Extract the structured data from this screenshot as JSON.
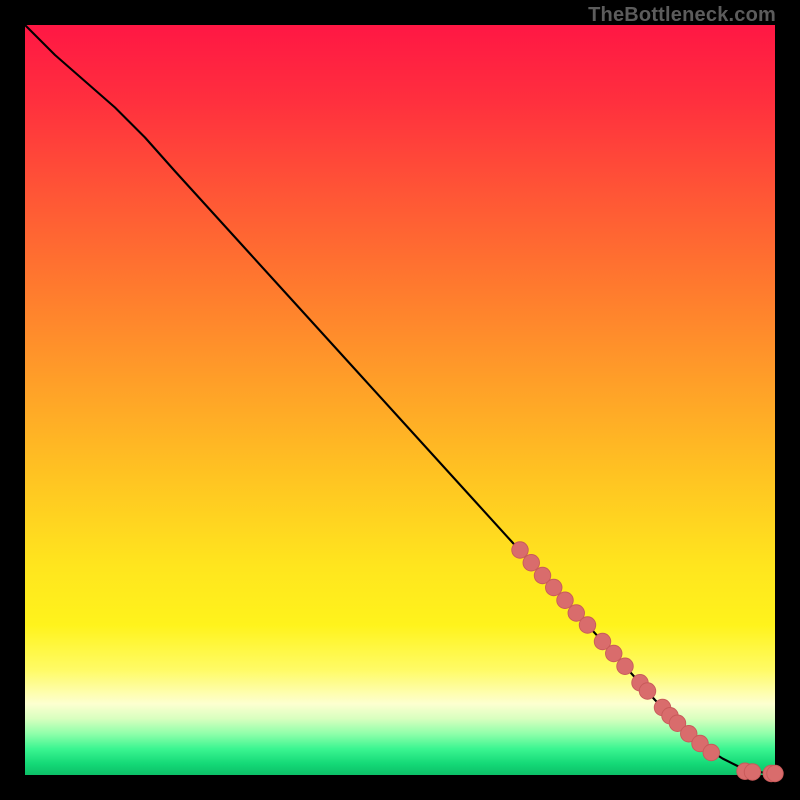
{
  "watermark": "TheBottleneck.com",
  "colors": {
    "black": "#000000",
    "curve": "#000000",
    "marker": "#d96c6c",
    "marker_stroke": "#c85a5a"
  },
  "gradient_stops": [
    {
      "offset": 0.0,
      "color": "#ff1744"
    },
    {
      "offset": 0.1,
      "color": "#ff2f3e"
    },
    {
      "offset": 0.22,
      "color": "#ff5436"
    },
    {
      "offset": 0.35,
      "color": "#ff7a2e"
    },
    {
      "offset": 0.48,
      "color": "#ffa028"
    },
    {
      "offset": 0.6,
      "color": "#ffc322"
    },
    {
      "offset": 0.72,
      "color": "#ffe51e"
    },
    {
      "offset": 0.8,
      "color": "#fff31c"
    },
    {
      "offset": 0.86,
      "color": "#fffb66"
    },
    {
      "offset": 0.905,
      "color": "#fdffd0"
    },
    {
      "offset": 0.925,
      "color": "#d8ffbf"
    },
    {
      "offset": 0.945,
      "color": "#8fffaa"
    },
    {
      "offset": 0.965,
      "color": "#3bf591"
    },
    {
      "offset": 0.985,
      "color": "#14d977"
    },
    {
      "offset": 1.0,
      "color": "#0cbf67"
    }
  ],
  "chart_data": {
    "type": "line",
    "title": "",
    "xlabel": "",
    "ylabel": "",
    "xlim": [
      0,
      100
    ],
    "ylim": [
      0,
      100
    ],
    "series": [
      {
        "name": "curve",
        "x": [
          0,
          4,
          8,
          12,
          16,
          20,
          25,
          30,
          35,
          40,
          45,
          50,
          55,
          60,
          65,
          70,
          75,
          80,
          84,
          88,
          91,
          93,
          95,
          97,
          98.5,
          100
        ],
        "y": [
          100,
          96,
          92.5,
          89,
          85,
          80.5,
          75,
          69.5,
          64,
          58.5,
          53,
          47.5,
          42,
          36.5,
          31,
          25.5,
          20,
          14.5,
          10,
          6,
          3.5,
          2.2,
          1.2,
          0.6,
          0.3,
          0.2
        ]
      }
    ],
    "markers": [
      {
        "x": 66,
        "y": 30
      },
      {
        "x": 67.5,
        "y": 28.3
      },
      {
        "x": 69,
        "y": 26.6
      },
      {
        "x": 70.5,
        "y": 25
      },
      {
        "x": 72,
        "y": 23.3
      },
      {
        "x": 73.5,
        "y": 21.6
      },
      {
        "x": 75,
        "y": 20
      },
      {
        "x": 77,
        "y": 17.8
      },
      {
        "x": 78.5,
        "y": 16.2
      },
      {
        "x": 80,
        "y": 14.5
      },
      {
        "x": 82,
        "y": 12.3
      },
      {
        "x": 83,
        "y": 11.2
      },
      {
        "x": 85,
        "y": 9.0
      },
      {
        "x": 86,
        "y": 7.9
      },
      {
        "x": 87,
        "y": 6.9
      },
      {
        "x": 88.5,
        "y": 5.5
      },
      {
        "x": 90,
        "y": 4.2
      },
      {
        "x": 91.5,
        "y": 3.0
      },
      {
        "x": 96,
        "y": 0.5
      },
      {
        "x": 97,
        "y": 0.4
      },
      {
        "x": 99.5,
        "y": 0.2
      },
      {
        "x": 100,
        "y": 0.2
      }
    ],
    "marker_radius_pct": 1.1
  }
}
